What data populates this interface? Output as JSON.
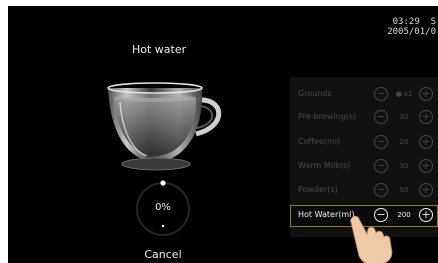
{
  "status": {
    "time": "03:29",
    "time_suffix": "S",
    "date": "2005/01/0"
  },
  "title": "Hot water",
  "progress": {
    "label": "0%",
    "value": 0
  },
  "cancel_label": "Cancel",
  "settings": [
    {
      "label": "Grounds",
      "value": "x1",
      "has_bean": true,
      "active": false
    },
    {
      "label": "Pre-brewing(s)",
      "value": "30",
      "active": false
    },
    {
      "label": "Coffee(ml)",
      "value": "20",
      "active": false
    },
    {
      "label": "Warm Milk(s)",
      "value": "30",
      "active": false
    },
    {
      "label": "Powder(s)",
      "value": "50",
      "active": false
    },
    {
      "label": "Hot Water(ml)",
      "value": "200",
      "active": true
    }
  ],
  "icons": {
    "minus": "minus-circle-icon",
    "plus": "plus-circle-icon",
    "bean": "coffee-bean-icon",
    "hand": "pointing-hand-icon"
  },
  "colors": {
    "background": "#000000",
    "active_border": "#8a7a3a",
    "text": "#f0f0f0",
    "inactive": "#4a4a4a"
  }
}
